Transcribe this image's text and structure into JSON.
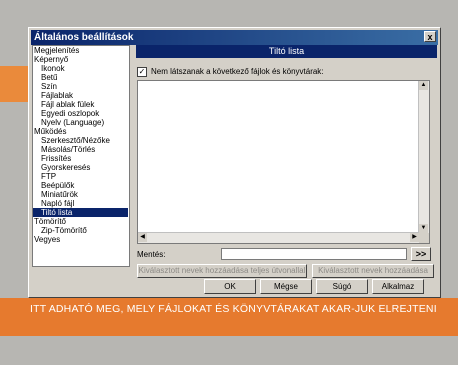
{
  "window": {
    "title": "Általános beállítások",
    "close_label": "x"
  },
  "tree": [
    {
      "label": "Megjelenítés",
      "child": false
    },
    {
      "label": "Képernyő",
      "child": false
    },
    {
      "label": "Ikonok",
      "child": true
    },
    {
      "label": "Betű",
      "child": true
    },
    {
      "label": "Szín",
      "child": true
    },
    {
      "label": "Fájlablak",
      "child": true
    },
    {
      "label": "Fájl ablak fülek",
      "child": true
    },
    {
      "label": "Egyedi oszlopok",
      "child": true
    },
    {
      "label": "Nyelv (Language)",
      "child": true
    },
    {
      "label": "Működés",
      "child": false
    },
    {
      "label": "Szerkesztő/Nézőke",
      "child": true
    },
    {
      "label": "Másolás/Törlés",
      "child": true
    },
    {
      "label": "Frissítés",
      "child": true
    },
    {
      "label": "Gyorskeresés",
      "child": true
    },
    {
      "label": "FTP",
      "child": true
    },
    {
      "label": "Beépülők",
      "child": true
    },
    {
      "label": "Miniatűrök",
      "child": true
    },
    {
      "label": "Napló fájl",
      "child": true
    },
    {
      "label": "Tiltó lista",
      "child": true,
      "selected": true
    },
    {
      "label": "Tömörítő",
      "child": false
    },
    {
      "label": "Zip-Tömörítő",
      "child": true
    },
    {
      "label": "Vegyes",
      "child": false
    }
  ],
  "panel": {
    "header": "Tiltó lista",
    "checkbox_mark": "✓",
    "checkbox_label": "Nem látszanak a következő fájlok és könyvtárak:",
    "mentes_label": "Mentés:",
    "mentes_value": "",
    "browse_label": ">>",
    "add_full_path": "Kiválasztott nevek hozzáadása teljes útvonallal",
    "add_names": "Kiválasztott nevek hozzáadása"
  },
  "buttons": {
    "ok": "OK",
    "cancel": "Mégse",
    "help": "Súgó",
    "apply": "Alkalmaz"
  },
  "caption": "ITT ADHATÓ MEG, MELY FÁJLOKAT ÉS KÖNYVTÁRAKAT AKAR-JUK ELREJTENI",
  "colors": {
    "accent": "#e67a2e",
    "titlebar": "#0a246a"
  }
}
